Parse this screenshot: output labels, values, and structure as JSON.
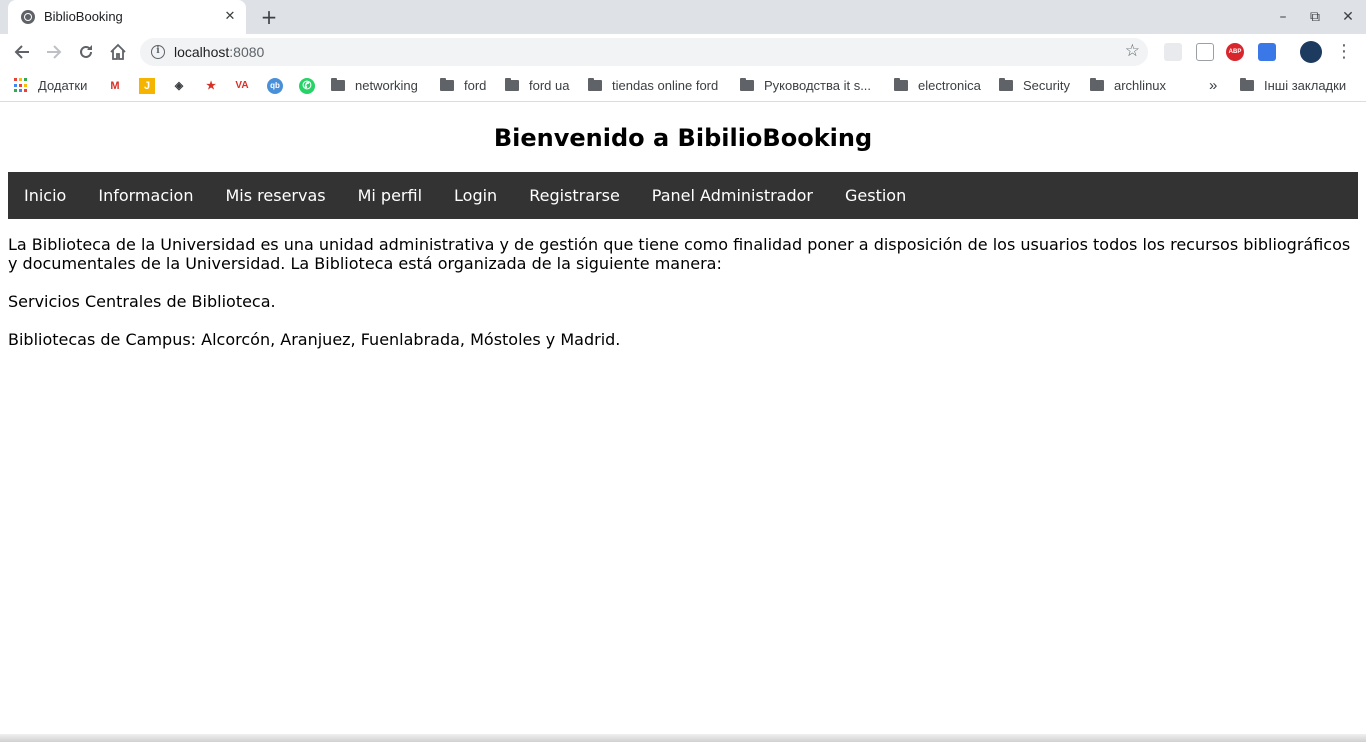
{
  "browser": {
    "tab_title": "BiblioBooking",
    "tab_close": "✕",
    "new_tab": "+",
    "window_controls": {
      "minimize": "–",
      "maximize": "⧉",
      "close": "✕"
    },
    "url_host": "localhost",
    "url_port": ":8080",
    "extensions": [
      "extension-puzzle-icon",
      "calendar-ext-icon",
      "adblock-plus-icon",
      "blue-ext-icon"
    ],
    "abp_text": "ABP"
  },
  "bookmarks": {
    "apps_label": "Додатки",
    "items": [
      {
        "label": "networking",
        "type": "folder"
      },
      {
        "label": "ford",
        "type": "folder"
      },
      {
        "label": "ford ua",
        "type": "folder"
      },
      {
        "label": "tiendas online ford",
        "type": "folder"
      },
      {
        "label": "Руководства it s...",
        "type": "folder"
      },
      {
        "label": "electronica",
        "type": "folder"
      },
      {
        "label": "Security",
        "type": "folder"
      },
      {
        "label": "archlinux",
        "type": "folder"
      }
    ],
    "overflow": "»",
    "other_label": "Інші закладки",
    "icon_colors": {
      "gmail": "#d93025",
      "j": "#f4b400",
      "wa": "#25d366",
      "qb": "#4a90d9"
    }
  },
  "page": {
    "title": "Bienvenido a BibilioBooking",
    "nav": [
      "Inicio",
      "Informacion",
      "Mis reservas",
      "Mi perfil",
      "Login",
      "Registrarse",
      "Panel Administrador",
      "Gestion"
    ],
    "paragraphs": [
      "La Biblioteca de la Universidad es una unidad administrativa y de gestión que tiene como finalidad poner a disposición de los usuarios todos los recursos bibliográficos y documentales de la Universidad. La Biblioteca está organizada de la siguiente manera:",
      "Servicios Centrales de Biblioteca.",
      "Bibliotecas de Campus: Alcorcón, Aranjuez, Fuenlabrada, Móstoles y Madrid."
    ],
    "navbar_color": "#333333"
  }
}
